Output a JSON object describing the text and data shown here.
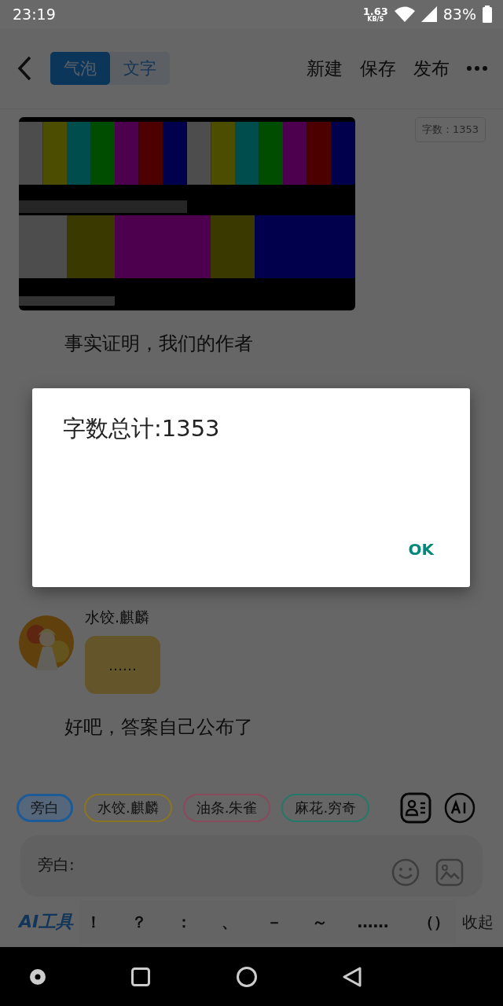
{
  "status_bar": {
    "time": "23:19",
    "net_speed": "1.63",
    "net_unit": "KB/S",
    "battery": "83%"
  },
  "header": {
    "tabs": [
      {
        "label": "气泡",
        "selected": true
      },
      {
        "label": "文字",
        "selected": false
      }
    ],
    "actions": [
      "新建",
      "保存",
      "发布"
    ]
  },
  "word_count_badge": "字数：1353",
  "story": [
    {
      "kind": "picture"
    },
    {
      "kind": "narration",
      "text": "事实证明，我们的作者"
    },
    {
      "kind": "message",
      "name": "水饺.麒麟",
      "text": "……",
      "color": "#64552a"
    },
    {
      "kind": "narration",
      "text": "好吧，答案自己公布了"
    }
  ],
  "characters": [
    {
      "name": "旁白",
      "color": "#1d5a98",
      "selected": true
    },
    {
      "name": "水饺.麒麟",
      "color": "#8a7424",
      "selected": false
    },
    {
      "name": "油条.朱雀",
      "color": "#8a4a5c",
      "selected": false
    },
    {
      "name": "麻花.穷奇",
      "color": "#247868",
      "selected": false
    }
  ],
  "input": {
    "placeholder": "旁白:"
  },
  "toolbar": {
    "ai_tools": "AI工具",
    "punctuation": [
      "！",
      "？",
      "：",
      "、",
      "－",
      "～",
      "……",
      "（）"
    ],
    "collapse": "收起"
  },
  "dialog": {
    "message": "字数总计:1353",
    "button": "OK"
  }
}
